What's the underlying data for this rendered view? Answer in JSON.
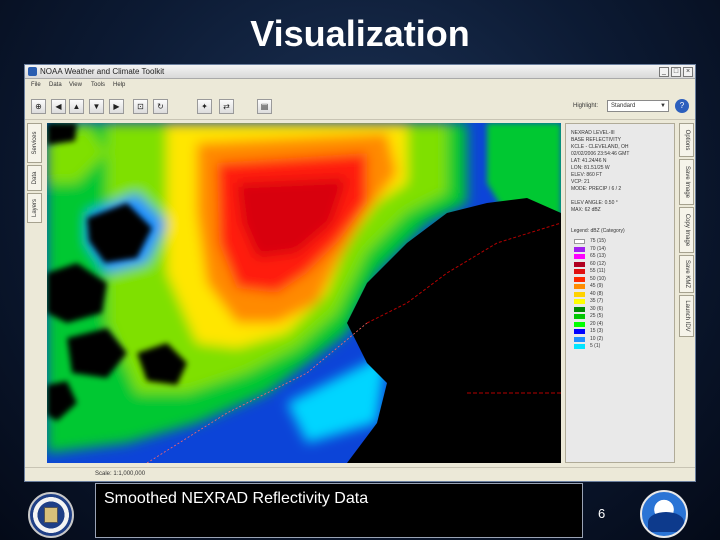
{
  "slide": {
    "title": "Visualization",
    "caption": "Smoothed NEXRAD Reflectivity Data",
    "page_number": "6"
  },
  "window": {
    "title": "NOAA Weather and Climate Toolkit",
    "controls": [
      "_",
      "□",
      "×"
    ]
  },
  "menu": [
    "File",
    "Data",
    "View",
    "Tools",
    "Help"
  ],
  "toolbar": {
    "buttons": [
      {
        "name": "zoom-in-button",
        "glyph": "⊕"
      },
      {
        "name": "pan-left-button",
        "glyph": "◀"
      },
      {
        "name": "pan-up-button",
        "glyph": "▲"
      },
      {
        "name": "pan-down-button",
        "glyph": "▼"
      },
      {
        "name": "pan-right-button",
        "glyph": "▶"
      },
      {
        "name": "select-button",
        "glyph": "⊡"
      },
      {
        "name": "rotate-button",
        "glyph": "↻"
      },
      {
        "name": "identify-button",
        "glyph": "✦"
      },
      {
        "name": "export-button",
        "glyph": "⇄"
      },
      {
        "name": "layers-button",
        "glyph": "▤"
      }
    ],
    "select_label": "Highlight:",
    "select_value": "Standard",
    "help_glyph": "?"
  },
  "left_tabs": [
    "Services",
    "Data",
    "Layers"
  ],
  "right_tabs": [
    "Options",
    "Save Image",
    "Copy Image",
    "Save KMZ",
    "Launch IDV"
  ],
  "info_panel": {
    "lines": [
      "NEXRAD LEVEL-III",
      "BASE REFLECTIVITY",
      "KCLE - CLEVELAND, OH",
      "02/02/2006 23:54:46 GMT",
      "LAT: 41.24/46 N",
      "LON: 81.51/25 W",
      "ELEV: 860 FT",
      "VCP: 21",
      "MODE: PRECIP / 6 / 2"
    ],
    "elevation_lines": [
      "ELEV ANGLE: 0.50 °",
      "MAX: 62 dBZ"
    ],
    "legend_title": "Legend: dBZ (Category)",
    "legend": [
      {
        "label": "75 (15)",
        "color": "#ffffff"
      },
      {
        "label": "70 (14)",
        "color": "#a020f0"
      },
      {
        "label": "65 (13)",
        "color": "#ff00ff"
      },
      {
        "label": "60 (12)",
        "color": "#b00020"
      },
      {
        "label": "55 (11)",
        "color": "#e01010"
      },
      {
        "label": "50 (10)",
        "color": "#ff2a00"
      },
      {
        "label": "45 (9)",
        "color": "#ff8c00"
      },
      {
        "label": "40 (8)",
        "color": "#ffd200"
      },
      {
        "label": "35 (7)",
        "color": "#ffff00"
      },
      {
        "label": "30 (6)",
        "color": "#008c00"
      },
      {
        "label": "25 (5)",
        "color": "#00c800"
      },
      {
        "label": "20 (4)",
        "color": "#00ff00"
      },
      {
        "label": "15 (3)",
        "color": "#0000ff"
      },
      {
        "label": "10 (2)",
        "color": "#1e90ff"
      },
      {
        "label": "5 (1)",
        "color": "#00e5ff"
      }
    ]
  },
  "status": "Scale: 1:1,000,000"
}
